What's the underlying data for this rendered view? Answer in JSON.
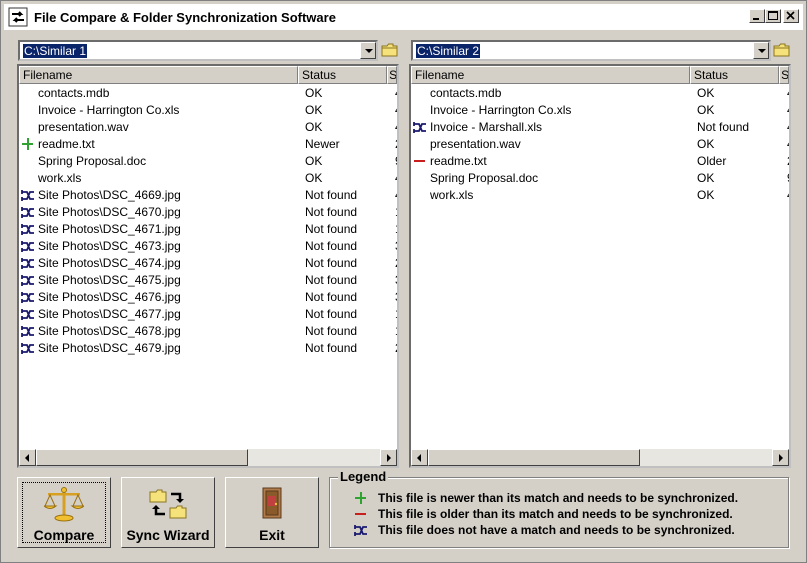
{
  "app": {
    "title": "File Compare & Folder Synchronization Software"
  },
  "colors": {
    "newer": "#2fa32f",
    "older": "#c81e1e",
    "nomatch": "#1a1a6e",
    "selection": "#0a246a"
  },
  "left_pane": {
    "path": "C:\\Similar 1",
    "columns": [
      "Filename",
      "Status",
      "S"
    ],
    "rows": [
      {
        "icon": "none",
        "name": "contacts.mdb",
        "status": "OK",
        "size": "4"
      },
      {
        "icon": "none",
        "name": "Invoice - Harrington Co.xls",
        "status": "OK",
        "size": "4"
      },
      {
        "icon": "none",
        "name": "presentation.wav",
        "status": "OK",
        "size": "4"
      },
      {
        "icon": "newer",
        "name": "readme.txt",
        "status": "Newer",
        "size": "2"
      },
      {
        "icon": "none",
        "name": "Spring Proposal.doc",
        "status": "OK",
        "size": "9"
      },
      {
        "icon": "none",
        "name": "work.xls",
        "status": "OK",
        "size": "4"
      },
      {
        "icon": "nomatch",
        "name": "Site Photos\\DSC_4669.jpg",
        "status": "Not found",
        "size": "4"
      },
      {
        "icon": "nomatch",
        "name": "Site Photos\\DSC_4670.jpg",
        "status": "Not found",
        "size": "1"
      },
      {
        "icon": "nomatch",
        "name": "Site Photos\\DSC_4671.jpg",
        "status": "Not found",
        "size": "1"
      },
      {
        "icon": "nomatch",
        "name": "Site Photos\\DSC_4673.jpg",
        "status": "Not found",
        "size": "3"
      },
      {
        "icon": "nomatch",
        "name": "Site Photos\\DSC_4674.jpg",
        "status": "Not found",
        "size": "2"
      },
      {
        "icon": "nomatch",
        "name": "Site Photos\\DSC_4675.jpg",
        "status": "Not found",
        "size": "3"
      },
      {
        "icon": "nomatch",
        "name": "Site Photos\\DSC_4676.jpg",
        "status": "Not found",
        "size": "3"
      },
      {
        "icon": "nomatch",
        "name": "Site Photos\\DSC_4677.jpg",
        "status": "Not found",
        "size": "1"
      },
      {
        "icon": "nomatch",
        "name": "Site Photos\\DSC_4678.jpg",
        "status": "Not found",
        "size": "1"
      },
      {
        "icon": "nomatch",
        "name": "Site Photos\\DSC_4679.jpg",
        "status": "Not found",
        "size": "2"
      }
    ]
  },
  "right_pane": {
    "path": "C:\\Similar 2",
    "columns": [
      "Filename",
      "Status",
      "S"
    ],
    "rows": [
      {
        "icon": "none",
        "name": "contacts.mdb",
        "status": "OK",
        "size": "4"
      },
      {
        "icon": "none",
        "name": "Invoice - Harrington Co.xls",
        "status": "OK",
        "size": "4"
      },
      {
        "icon": "nomatch",
        "name": "Invoice - Marshall.xls",
        "status": "Not found",
        "size": "4"
      },
      {
        "icon": "none",
        "name": "presentation.wav",
        "status": "OK",
        "size": "4"
      },
      {
        "icon": "older",
        "name": "readme.txt",
        "status": "Older",
        "size": "2"
      },
      {
        "icon": "none",
        "name": "Spring Proposal.doc",
        "status": "OK",
        "size": "9"
      },
      {
        "icon": "none",
        "name": "work.xls",
        "status": "OK",
        "size": "4"
      }
    ]
  },
  "buttons": {
    "compare": "Compare",
    "sync_wizard": "Sync Wizard",
    "exit": "Exit"
  },
  "legend": {
    "title": "Legend",
    "items": [
      {
        "icon": "newer",
        "text": "This file is newer than its match and needs to be synchronized."
      },
      {
        "icon": "older",
        "text": "This file is older than its match and needs to be synchronized."
      },
      {
        "icon": "nomatch",
        "text": "This file does not have a match and needs to be synchronized."
      }
    ]
  }
}
